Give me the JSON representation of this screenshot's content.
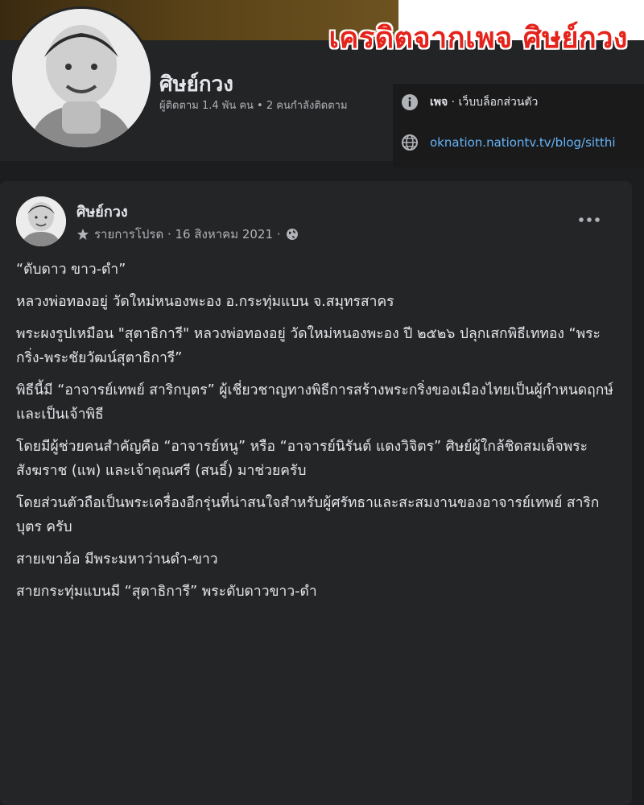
{
  "credit_banner": "เครดิตจากเพจ ศิษย์กวง",
  "page": {
    "name": "ศิษย์กวง",
    "followers": "ผู้ติดตาม 1.4 พัน คน • 2 คนกำลังติดตาม"
  },
  "intro": {
    "type_bold": "เพจ",
    "type_rest": " · เว็บบล็อกส่วนตัว",
    "website": "oknation.nationtv.tv/blog/sitthi"
  },
  "post": {
    "author": "ศิษย์กวง",
    "meta": "รายการโปรด · 16 สิงหาคม 2021 ·",
    "paragraphs": [
      "“ดับดาว ขาว-ดำ”",
      "หลวงพ่อทองอยู่ วัดใหม่หนองพะอง อ.กระทุ่มแบน จ.สมุทรสาคร",
      "พระผงรูปเหมือน \"สุตาธิการี\" หลวงพ่อทองอยู่ วัดใหม่หนองพะอง ปี ๒๕๒๖ ปลุกเสกพิธีเททอง “พระกริ่ง-พระชัยวัฒน์สุตาธิการี”",
      "พิธีนี้มี “อาจารย์เทพย์ สาริกบุตร” ผู้เชี่ยวชาญทางพิธีการสร้างพระกริ่งของเมืองไทยเป็นผู้กำหนดฤกษ์และเป็นเจ้าพิธี",
      "โดยมีผู้ช่วยคนสำคัญคือ “อาจารย์หนู” หรือ “อาจารย์นิรันต์ แดงวิจิตร” ศิษย์ผู้ใกล้ชิดสมเด็จพระสังฆราช (แพ) และเจ้าคุณศรี (สนธิ์) มาช่วยครับ",
      "โดยส่วนตัวถือเป็นพระเครื่องอีกรุ่นที่น่าสนใจสำหรับผู้ศรัทธาและสะสมงานของอาจารย์เทพย์ สาริกบุตร ครับ",
      "สายเขาอ้อ มีพระมหาว่านดำ-ขาว",
      "สายกระทุ่มแบนมี “สุตาธิการี” พระดับดาวขาว-ดำ"
    ]
  },
  "icons": {
    "info": "info-icon",
    "globe": "globe-icon",
    "star": "star-icon",
    "more": "more-horizontal-icon"
  },
  "colors": {
    "background": "#1c1d1f",
    "card": "#242526",
    "text": "#e4e6eb",
    "muted": "#b0b3b8",
    "link": "#65b3f7",
    "banner": "#e5231b"
  }
}
